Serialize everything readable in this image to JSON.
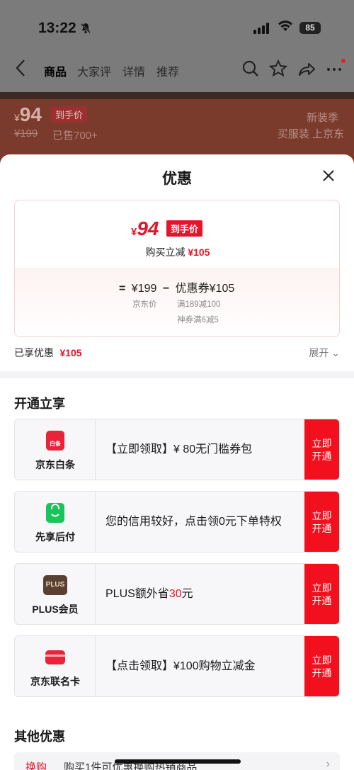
{
  "status_bar": {
    "time": "13:22",
    "battery": "85"
  },
  "nav": {
    "tabs": [
      "商品",
      "大家评",
      "详情",
      "推荐"
    ],
    "active_tab": "商品"
  },
  "background_banner": {
    "currency": "¥",
    "price": "94",
    "price_tag": "到手价",
    "original_price": "¥199",
    "sold": "已售700+",
    "promo_line1": "新装季",
    "promo_line2": "买服装 上京东"
  },
  "sheet": {
    "title": "优惠",
    "price_card": {
      "currency": "¥",
      "final_price": "94",
      "final_tag": "到手价",
      "reduce_label": "购买立减",
      "reduce_amount": "¥105",
      "equals": "=",
      "list_price": "¥199",
      "minus": "−",
      "coupon_label": "优惠券¥105",
      "list_price_caption": "京东价",
      "coupon_detail_1": "满189减100",
      "coupon_detail_2": "神券满6减5"
    },
    "enjoyed": {
      "label": "已享优惠",
      "amount": "¥105",
      "expand": "展开"
    },
    "open_section": {
      "title": "开通立享",
      "offers": [
        {
          "name": "京东白条",
          "desc": "【立即领取】¥ 80无门槛券包",
          "cta": "立即开通",
          "logo_color": "#e8233a",
          "logo_text": "白条"
        },
        {
          "name": "先享后付",
          "desc": "您的信用较好，点击领0元下单特权",
          "cta": "立即开通",
          "logo_color": "#19c45a"
        },
        {
          "name": "PLUS会员",
          "desc_prefix": "PLUS额外省",
          "desc_highlight": "30",
          "desc_suffix": "元",
          "cta": "立即开通",
          "logo_color": "#5a3f33",
          "logo_text": "PLUS"
        },
        {
          "name": "京东联名卡",
          "desc": "【点击领取】¥100购物立减金",
          "cta": "立即开通",
          "logo_color": "#e8233a"
        }
      ]
    },
    "other_section": {
      "title": "其他优惠",
      "row_tag": "换购",
      "row_text": "购买1件可优惠换购热销商品"
    }
  }
}
